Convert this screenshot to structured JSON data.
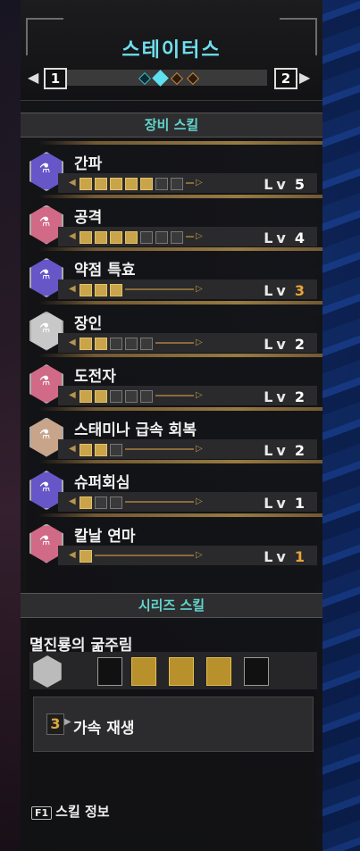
{
  "header": {
    "title": "스테이터스",
    "page_left": "1",
    "page_right": "2",
    "dots": [
      {
        "color": "#3fb8c8",
        "state": "normal"
      },
      {
        "color": "#5fe0ee",
        "state": "active"
      },
      {
        "color": "#c88640",
        "state": "normal"
      },
      {
        "color": "#c88640",
        "state": "normal"
      }
    ]
  },
  "equipment": {
    "heading": "장비 스킬",
    "lv_label": "Lv",
    "skills": [
      {
        "name": "간파",
        "level": "5",
        "filled": 5,
        "max": 7,
        "color": "#6656c8",
        "max_color": "#ffffff"
      },
      {
        "name": "공격",
        "level": "4",
        "filled": 4,
        "max": 7,
        "color": "#d06a86",
        "max_color": "#ffffff"
      },
      {
        "name": "약점 특효",
        "level": "3",
        "filled": 3,
        "max": 3,
        "color": "#6656c8",
        "max_color": "#e6a43a"
      },
      {
        "name": "장인",
        "level": "2",
        "filled": 2,
        "max": 5,
        "color": "#c8c8c8",
        "max_color": "#ffffff"
      },
      {
        "name": "도전자",
        "level": "2",
        "filled": 2,
        "max": 5,
        "color": "#d06a86",
        "max_color": "#ffffff"
      },
      {
        "name": "스태미나 급속 회복",
        "level": "2",
        "filled": 2,
        "max": 3,
        "color": "#c8a48a",
        "max_color": "#ffffff"
      },
      {
        "name": "슈퍼회심",
        "level": "1",
        "filled": 1,
        "max": 3,
        "color": "#6656c8",
        "max_color": "#ffffff"
      },
      {
        "name": "칼날 연마",
        "level": "1",
        "filled": 1,
        "max": 1,
        "color": "#d06a86",
        "max_color": "#e6a43a"
      }
    ]
  },
  "series": {
    "heading": "시리즈 스킬",
    "name": "멸진룡의 굶주림",
    "pieces_equipped": 3,
    "bonus_count": "3",
    "bonus_name": "가속 재생"
  },
  "footer": {
    "key": "F1",
    "label": "스킬 정보"
  }
}
